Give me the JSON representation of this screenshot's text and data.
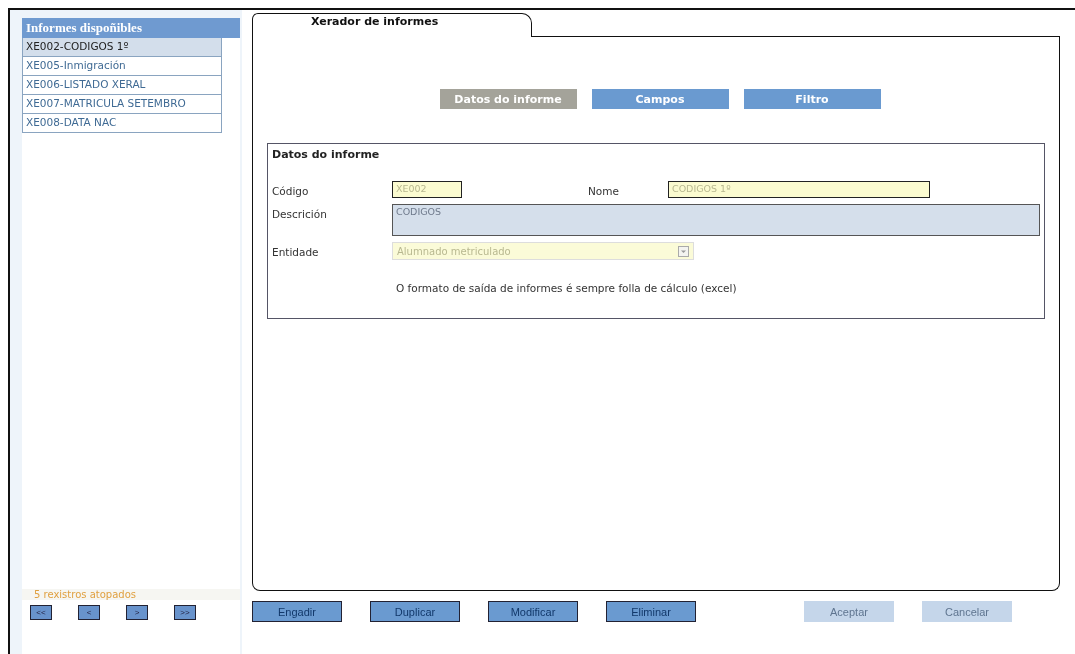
{
  "sidebar": {
    "title": "Informes dispoñibles",
    "items": [
      {
        "label": "XE002-CODIGOS 1º",
        "selected": true
      },
      {
        "label": "XE005-Inmigración",
        "selected": false
      },
      {
        "label": "XE006-LISTADO XERAL",
        "selected": false
      },
      {
        "label": "XE007-MATRICULA SETEMBRO",
        "selected": false
      },
      {
        "label": "XE008-DATA NAC",
        "selected": false
      }
    ],
    "record_count": "5 rexistros atopados",
    "pager": [
      "<<",
      "<",
      ">",
      ">>"
    ]
  },
  "main_tab": "Xerador de informes",
  "sections": [
    {
      "label": "Datos do informe",
      "selected": true
    },
    {
      "label": "Campos",
      "selected": false
    },
    {
      "label": "Filtro",
      "selected": false
    }
  ],
  "form": {
    "title": "Datos do informe",
    "codigo": {
      "label": "Código",
      "value": "XE002"
    },
    "nome": {
      "label": "Nome",
      "value": "CODIGOS 1º"
    },
    "descricion": {
      "label": "Descrición",
      "value": "CODIGOS"
    },
    "entidade": {
      "label": "Entidade",
      "value": "Alumnado metriculado"
    },
    "note": "O formato de saída de informes é sempre folla de cálculo (excel)"
  },
  "buttons": [
    {
      "label": "Engadir",
      "disabled": false
    },
    {
      "label": "Duplicar",
      "disabled": false
    },
    {
      "label": "Modificar",
      "disabled": false
    },
    {
      "label": "Eliminar",
      "disabled": false
    },
    {
      "label": "Aceptar",
      "disabled": true
    },
    {
      "label": "Cancelar",
      "disabled": true
    }
  ]
}
